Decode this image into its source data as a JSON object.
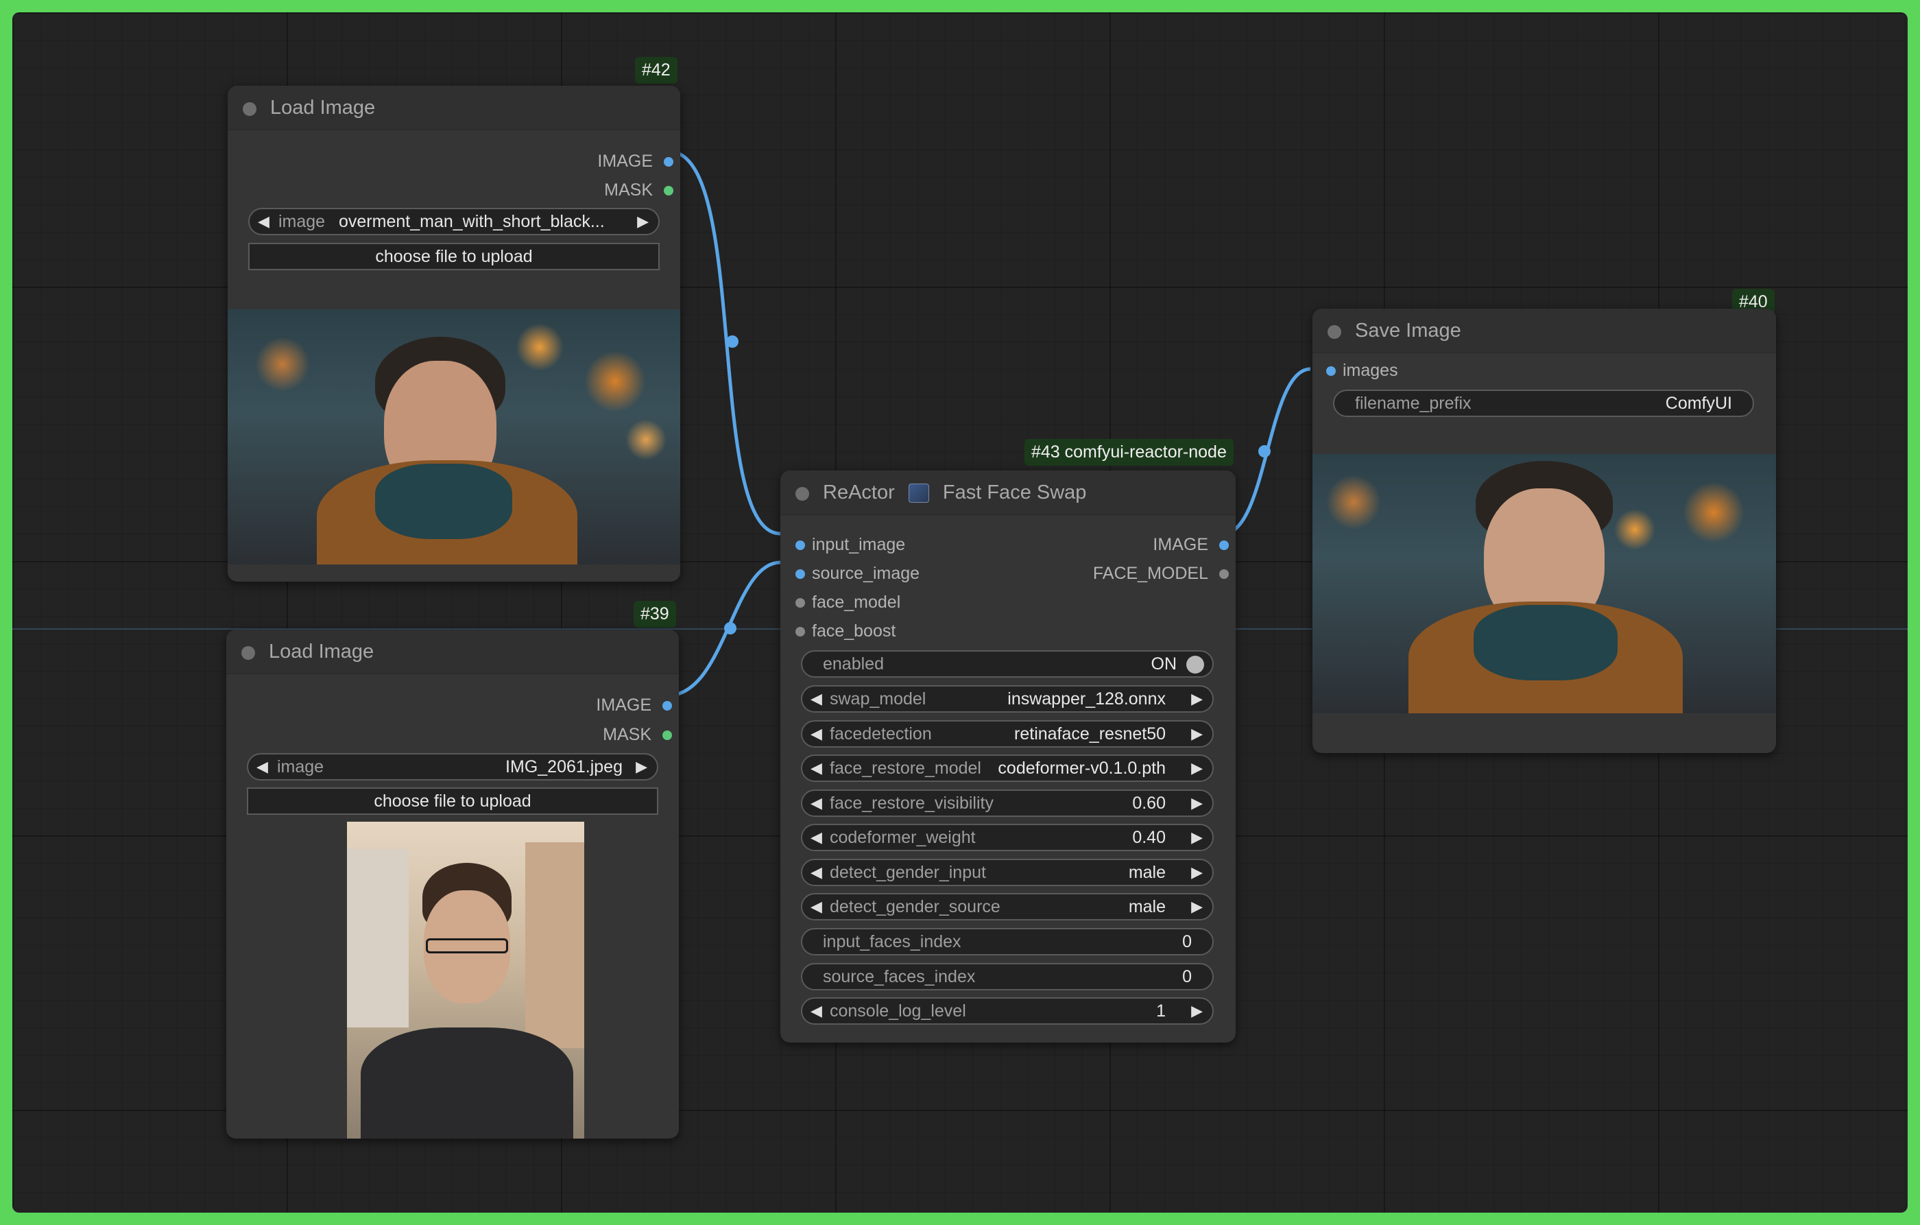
{
  "colors": {
    "image_link": "#5aa6e8",
    "image_slot": "#5aa6e8",
    "mask_slot": "#5cc87a",
    "face_model_slot": "#888888",
    "badge_bg": "#1b3a1b"
  },
  "nodes": {
    "load_image_1": {
      "badge": "#42",
      "title": "Load Image",
      "outputs": [
        "IMAGE",
        "MASK"
      ],
      "image_widget": {
        "name": "image",
        "value": "overment_man_with_short_black..."
      },
      "upload_label": "choose file to upload",
      "preview_icon": "portrait-photo-man-in-jacket-icon"
    },
    "load_image_2": {
      "badge": "#39",
      "title": "Load Image",
      "outputs": [
        "IMAGE",
        "MASK"
      ],
      "image_widget": {
        "name": "image",
        "value": "IMG_2061.jpeg"
      },
      "upload_label": "choose file to upload",
      "preview_icon": "selfie-photo-man-with-glasses-icon"
    },
    "reactor": {
      "badge": "#43 comfyui-reactor-node",
      "title_a": "ReActor",
      "title_b": "Fast Face Swap",
      "title_icon": "picture-emoji-icon",
      "inputs": [
        "input_image",
        "source_image",
        "face_model",
        "face_boost"
      ],
      "outputs": [
        "IMAGE",
        "FACE_MODEL"
      ],
      "enabled": {
        "name": "enabled",
        "value": "ON"
      },
      "widgets": [
        {
          "name": "swap_model",
          "value": "inswapper_128.onnx"
        },
        {
          "name": "facedetection",
          "value": "retinaface_resnet50"
        },
        {
          "name": "face_restore_model",
          "value": "codeformer-v0.1.0.pth"
        },
        {
          "name": "face_restore_visibility",
          "value": "0.60"
        },
        {
          "name": "codeformer_weight",
          "value": "0.40"
        },
        {
          "name": "detect_gender_input",
          "value": "male"
        },
        {
          "name": "detect_gender_source",
          "value": "male"
        }
      ],
      "number_widgets": [
        {
          "name": "input_faces_index",
          "value": "0"
        },
        {
          "name": "source_faces_index",
          "value": "0"
        }
      ],
      "log_widget": {
        "name": "console_log_level",
        "value": "1"
      }
    },
    "save_image": {
      "badge": "#40",
      "title": "Save Image",
      "inputs": [
        "images"
      ],
      "prefix_widget": {
        "name": "filename_prefix",
        "value": "ComfyUI"
      },
      "preview_icon": "swapped-face-result-photo-icon"
    }
  }
}
